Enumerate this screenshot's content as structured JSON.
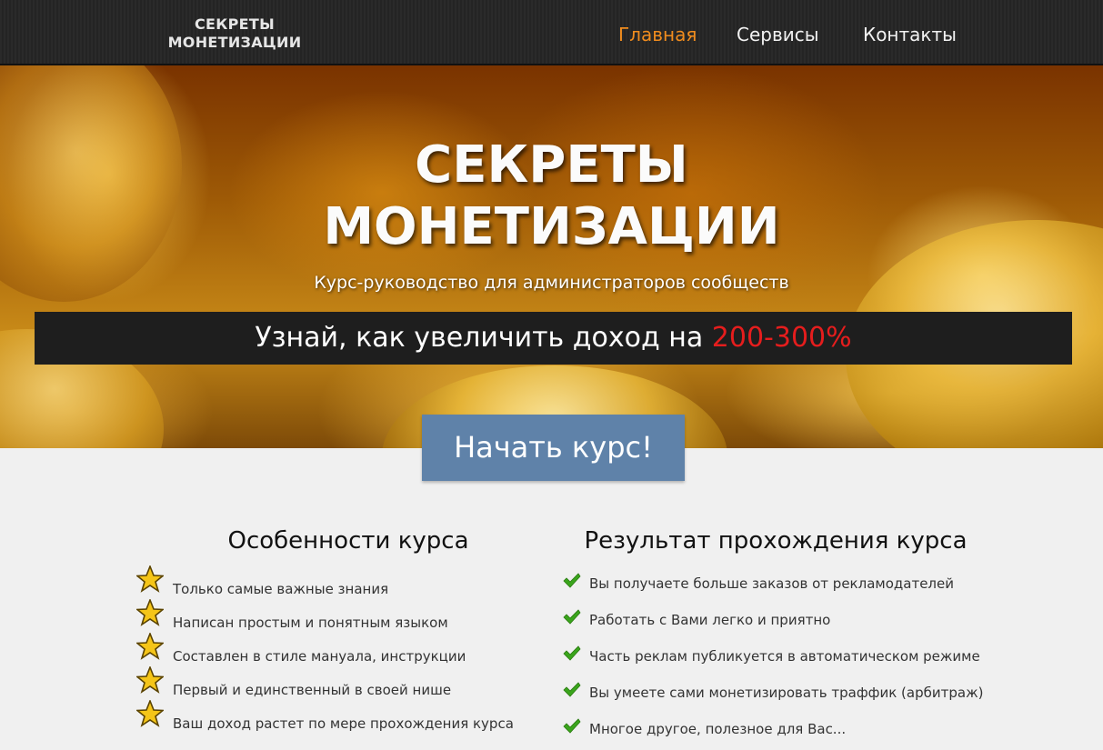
{
  "header": {
    "logo_line1": "СЕКРЕТЫ",
    "logo_line2": "МОНЕТИЗАЦИИ",
    "nav": [
      {
        "label": "Главная",
        "active": true
      },
      {
        "label": "Сервисы",
        "active": false
      },
      {
        "label": "Контакты",
        "active": false
      }
    ],
    "active_color": "#f08c1e"
  },
  "hero": {
    "title_line1": "СЕКРЕТЫ",
    "title_line2": "МОНЕТИЗАЦИИ",
    "subtitle": "Курс-руководство для администраторов сообществ",
    "banner_text": "Узнай, как увеличить доход на ",
    "banner_highlight": "200-300%",
    "highlight_color": "#e51d1d",
    "cta_label": "Начать курс!",
    "cta_color": "#5f82a9"
  },
  "features": {
    "title": "Особенности курса",
    "icon": "star-icon",
    "items": [
      "Только самые важные знания",
      "Написан простым и понятным языком",
      "Составлен в стиле мануала, инструкции",
      "Первый и единственный в своей нише",
      "Ваш доход растет по мере прохождения курса"
    ]
  },
  "results": {
    "title": "Результат прохождения курса",
    "icon": "checkmark-icon",
    "items": [
      "Вы получаете больше заказов от рекламодателей",
      "Работать с Вами легко и приятно",
      "Часть реклам публикуется в автоматическом режиме",
      "Вы умеете сами монетизировать траффик (арбитраж)",
      "Многое другое, полезное для Вас..."
    ]
  }
}
